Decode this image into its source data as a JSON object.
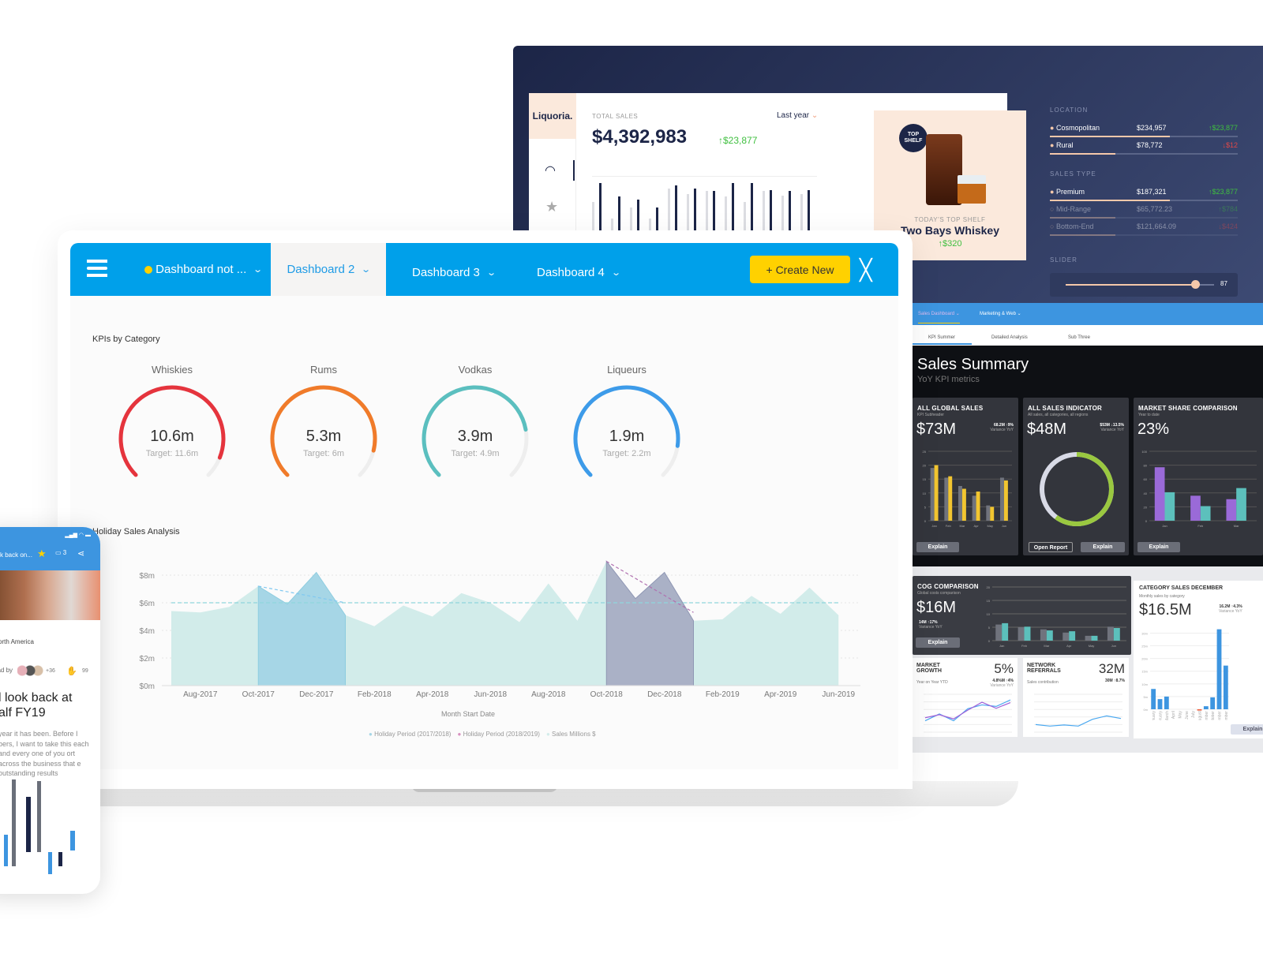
{
  "liquoria": {
    "logo": "Liquoria.",
    "total_sales_label": "TOTAL SALES",
    "total_sales": "$4,392,983",
    "delta": "↑$23,877",
    "period": "Last year",
    "bars": [
      [
        0.6,
        0.95
      ],
      [
        0.3,
        0.7
      ],
      [
        0.5,
        0.65
      ],
      [
        0.3,
        0.5
      ],
      [
        0.85,
        0.9
      ],
      [
        0.75,
        0.85
      ],
      [
        0.8,
        0.8
      ],
      [
        0.7,
        0.95
      ],
      [
        0.6,
        0.95
      ],
      [
        0.8,
        0.82
      ],
      [
        0.72,
        0.8
      ],
      [
        0.75,
        0.82
      ]
    ]
  },
  "promo": {
    "badge": "TOP SHELF",
    "caption": "TODAY'S TOP SHELF",
    "product": "Two Bays Whiskey",
    "delta": "↑$320"
  },
  "filters": {
    "location_label": "LOCATION",
    "location": [
      {
        "name": "Cosmopolitan",
        "value": "$234,957",
        "delta": "↑$23,877",
        "dir": "up",
        "share": 0.64,
        "active": true
      },
      {
        "name": "Rural",
        "value": "$78,772",
        "delta": "↓$12",
        "dir": "down",
        "share": 0.35,
        "active": true
      }
    ],
    "sales_type_label": "SALES TYPE",
    "sales_type": [
      {
        "name": "Premium",
        "value": "$187,321",
        "delta": "↑$23,877",
        "dir": "up",
        "share": 0.64,
        "active": true
      },
      {
        "name": "Mid-Range",
        "value": "$65,772.23",
        "delta": "↑$784",
        "dir": "up",
        "share": 0.35,
        "active": false
      },
      {
        "name": "Bottom-End",
        "value": "$121,664.09",
        "delta": "↓$424",
        "dir": "down",
        "share": 0.35,
        "active": false
      }
    ],
    "slider_label": "SLIDER",
    "slider_value": "87",
    "slider_fraction": 0.87
  },
  "topbar": {
    "tabs": [
      "Dashboard not ...",
      "Dashboard 2",
      "Dashboard 3",
      "Dashboard 4"
    ],
    "active_tab": 1,
    "create_label": "+ Create New",
    "accent": "#00a0ea",
    "button_color": "#ffd100"
  },
  "kpis": {
    "title": "KPIs by Category",
    "items": [
      {
        "name": "Whiskies",
        "value": "10.6m",
        "target": "Target: 11.6m",
        "v": 10.6,
        "t": 11.6,
        "color": "#e5343d"
      },
      {
        "name": "Rums",
        "value": "5.3m",
        "target": "Target: 6m",
        "v": 5.3,
        "t": 6,
        "color": "#f07b2a"
      },
      {
        "name": "Vodkas",
        "value": "3.9m",
        "target": "Target: 4.9m",
        "v": 3.9,
        "t": 4.9,
        "color": "#5bbfbf"
      },
      {
        "name": "Liqueurs",
        "value": "1.9m",
        "target": "Target: 2.2m",
        "v": 1.9,
        "t": 2.2,
        "color": "#3d9be9"
      }
    ]
  },
  "chart_data": {
    "type": "area",
    "title": "Holiday Sales Analysis",
    "xlabel": "Month Start Date",
    "ylabel": "",
    "yticks": [
      "$0m",
      "$2m",
      "$4m",
      "$6m",
      "$8m"
    ],
    "ylim": [
      0,
      9.5
    ],
    "average": 6,
    "xticks": [
      "Aug-2017",
      "Oct-2017",
      "Dec-2017",
      "Feb-2018",
      "Apr-2018",
      "Jun-2018",
      "Aug-2018",
      "Oct-2018",
      "Dec-2018",
      "Feb-2019",
      "Apr-2019",
      "Jun-2019"
    ],
    "x": [
      "Jul-2017",
      "Aug-2017",
      "Sep-2017",
      "Oct-2017",
      "Nov-2017",
      "Dec-2017",
      "Jan-2018",
      "Feb-2018",
      "Mar-2018",
      "Apr-2018",
      "May-2018",
      "Jun-2018",
      "Jul-2018",
      "Aug-2018",
      "Sep-2018",
      "Oct-2018",
      "Nov-2018",
      "Dec-2018",
      "Jan-2019",
      "Feb-2019",
      "Mar-2019",
      "Apr-2019",
      "May-2019",
      "Jun-2019"
    ],
    "values": [
      5.4,
      5.3,
      5.7,
      7.2,
      5.9,
      8.2,
      5.1,
      4.3,
      5.8,
      5.0,
      6.7,
      6.0,
      4.6,
      7.4,
      4.7,
      9.0,
      6.3,
      8.2,
      4.7,
      4.8,
      6.5,
      5.2,
      7.1,
      5.1
    ],
    "series": [
      {
        "name": "Holiday Period (2017/2018)",
        "from": "Oct-2017",
        "to": "Jan-2018",
        "color": "#a6d6e6"
      },
      {
        "name": "Holiday Period (2018/2019)",
        "from": "Oct-2018",
        "to": "Jan-2019",
        "color": "#aab1c6"
      },
      {
        "name": "Sales Millions $",
        "color": "#d2ecea"
      }
    ],
    "legend": "bottom",
    "grid": true
  },
  "dash2": {
    "tabs": [
      "Sales Dashboard",
      "Marketing & Web"
    ],
    "subtabs": [
      "KPI Summer",
      "Detailed Analysis",
      "Sub Three"
    ],
    "title": "Sales Summary",
    "subtitle": "YoY KPI metrics",
    "global": {
      "title": "ALL GLOBAL SALES",
      "sub": "KPI Subheader",
      "value": "$73M",
      "var": "68.2M ↑9%",
      "var_label": "Variance YoY",
      "months": [
        "Jan",
        "Feb",
        "Mar",
        "Apr",
        "May",
        "Jun"
      ],
      "a": [
        19,
        15.5,
        12.5,
        9,
        5.5,
        15.5
      ],
      "b": [
        20,
        16,
        11.5,
        10.5,
        5,
        14.5
      ],
      "btn": "Explain"
    },
    "indicator": {
      "title": "ALL SALES INDICATOR",
      "sub": "All sales, all categories, all regions",
      "value": "$48M",
      "var": "$53M ↓13.5%",
      "var_label": "Variance YoY",
      "fraction": 0.6,
      "btn1": "Open Report",
      "btn2": "Explain"
    },
    "share": {
      "title": "MARKET SHARE COMPARISON",
      "sub": "Year to date",
      "value": "23%",
      "months": [
        "Jan",
        "Feb",
        "Mar"
      ],
      "a": [
        77,
        36,
        31
      ],
      "b": [
        41,
        21,
        47
      ],
      "btn": "Explain"
    },
    "cog": {
      "title": "COG COMPARISON",
      "sub": "Global costs comparison",
      "value": "$16M",
      "var": "14M ↑17%",
      "var_label": "Variance YoY",
      "months": [
        "Jan",
        "Feb",
        "Mar",
        "Apr",
        "May",
        "Jun"
      ],
      "a": [
        6,
        5,
        4.2,
        3,
        1.8,
        5.2
      ],
      "b": [
        6.5,
        5.2,
        3.8,
        3.5,
        1.8,
        4.7
      ],
      "btn": "Explain"
    },
    "growth": {
      "title": "MARKET GROWTH",
      "sub": "Year on Year YTD",
      "value": "5%",
      "var": "4.8%M ↑4%",
      "var_label": "Variance YoY",
      "a": [
        30,
        48,
        30,
        62,
        72,
        68,
        85
      ],
      "b": [
        38,
        46,
        35,
        58,
        79,
        63,
        78
      ]
    },
    "referrals": {
      "title": "NETWORK REFERRALS",
      "sub": "Sales contribution",
      "value": "32M",
      "var": "30M ↑8.7%",
      "a": [
        20,
        16,
        19,
        16,
        34,
        43,
        36
      ]
    },
    "category": {
      "title": "CATEGORY SALES DECEMBER",
      "sub": "Monthly sales by category",
      "value": "$16.5M",
      "var": "16.2M ↑4.3%",
      "var_label": "Variance YoY",
      "months": [
        "January",
        "February",
        "March",
        "April",
        "May",
        "June",
        "July",
        "August",
        "September",
        "October",
        "November",
        "December"
      ],
      "values": [
        8,
        4,
        5,
        0,
        0,
        0,
        0,
        -0.5,
        1.2,
        4.7,
        31.5,
        17.2
      ],
      "btn": "Explain"
    }
  },
  "phone": {
    "title": "k back on...",
    "comments": "3",
    "region": "orth America",
    "read_by": "ead by",
    "readers_more": "+36",
    "claps": "99",
    "headline": "l look back at alf FY19",
    "body": "year it has been. Before I bers, I want to take this each and every one of you ort across the business that e outstanding results"
  }
}
